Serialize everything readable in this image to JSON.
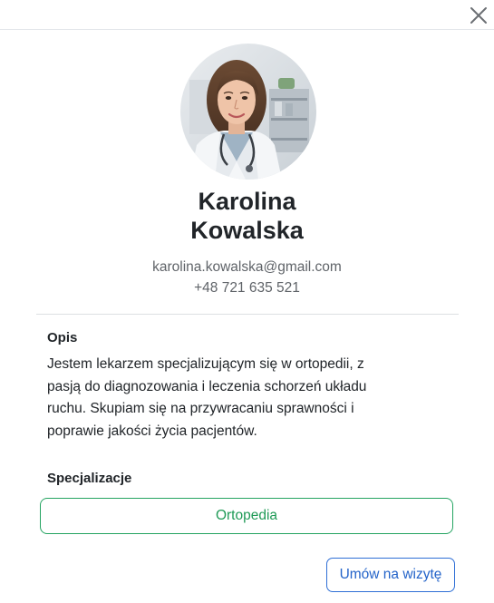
{
  "doctor": {
    "first_name": "Karolina",
    "last_name": "Kowalska",
    "email": "karolina.kowalska@gmail.com",
    "phone": "+48 721 635 521"
  },
  "description": {
    "title": "Opis",
    "text": "Jestem lekarzem specjalizującym się w ortopedii, z pasją do diagnozowania i leczenia schorzeń układu ruchu. Skupiam się na przywracaniu sprawności i poprawie jakości życia pacjentów."
  },
  "specializations": {
    "title": "Specjalizacje",
    "items": [
      "Ortopedia"
    ]
  },
  "actions": {
    "book_label": "Umów na wizytę"
  },
  "icons": {
    "close": "close-icon",
    "avatar": "doctor-avatar-photo"
  },
  "colors": {
    "specialization_accent": "#1f9a56",
    "primary_button": "#2363c9",
    "text_muted": "#5f6368"
  }
}
